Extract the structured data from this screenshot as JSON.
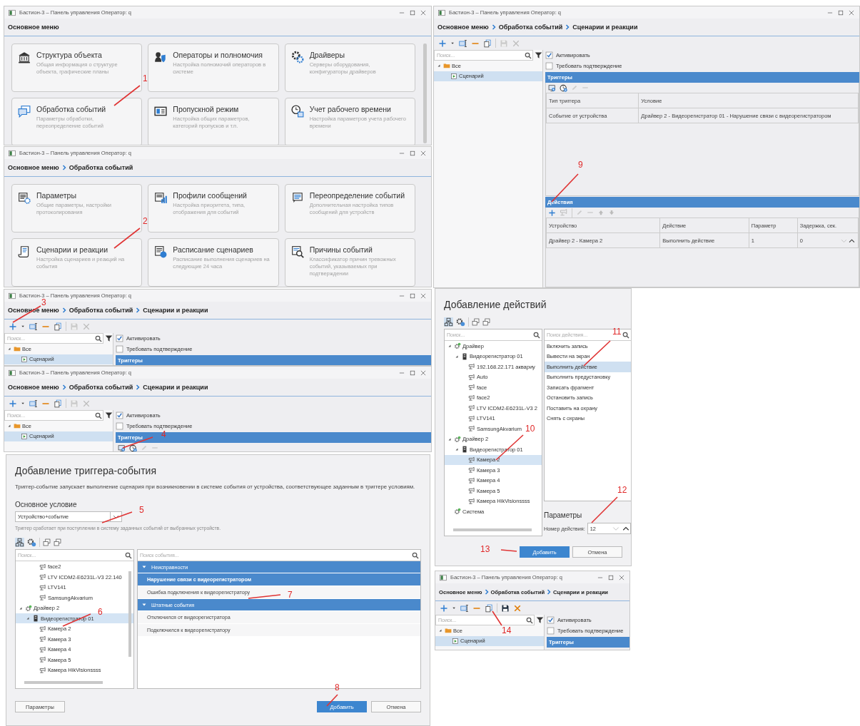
{
  "panels": [
    {
      "kind": "menu",
      "title": "Бастион-3 – Панель управления Оператор: q",
      "breadcrumb": [
        "Основное меню"
      ],
      "cards": [
        {
          "title": "Структура объекта",
          "description": "Общая информация о структуре объекта, графические планы"
        },
        {
          "title": "Операторы и полномочия",
          "description": "Настройка полномочий операторов в системе"
        },
        {
          "title": "Драйверы",
          "description": "Серверы оборудования, конфигураторы драйверов"
        },
        {
          "title": "Обработка событий",
          "description": "Параметры обработки, переопределение событий"
        },
        {
          "title": "Пропускной режим",
          "description": "Настройка общих параметров, категорий пропусков и т.п."
        },
        {
          "title": "Учет рабочего времени",
          "description": "Настройка параметров учета рабочего времени"
        }
      ]
    },
    {
      "kind": "menu",
      "title": "Бастион-3 – Панель управления Оператор: q",
      "breadcrumb": [
        "Основное меню",
        "Обработка событий"
      ],
      "cards": [
        {
          "title": "Параметры",
          "description": "Общие параметры, настройки протоколирования"
        },
        {
          "title": "Профили сообщений",
          "description": "Настройка приоритета, типа, отображения для событий"
        },
        {
          "title": "Переопределение событий",
          "description": "Дополнительная настройка типов сообщений для устройств"
        },
        {
          "title": "Сценарии и реакции",
          "description": "Настройка сценариев и реакций на события"
        },
        {
          "title": "Расписание сценариев",
          "description": "Расписание выполнения сценариев на следующие 24 часа"
        },
        {
          "title": "Причины событий",
          "description": "Классификатор причин тревожных событий, указываемых при подтверждении"
        }
      ]
    },
    {
      "kind": "scenario",
      "title": "Бастион-3 – Панель управления Оператор: q",
      "breadcrumb": [
        "Основное меню",
        "Обработка событий",
        "Сценарии и реакции"
      ],
      "save_enabled": false,
      "search_placeholder": "Поиск...",
      "tree": [
        {
          "label": "Все",
          "kind": "folder",
          "expanded": true,
          "selected": false,
          "children": [
            {
              "label": "Сценарий",
              "kind": "script",
              "selected": true
            }
          ]
        }
      ],
      "checkboxes": [
        {
          "label": "Активировать",
          "checked": true
        },
        {
          "label": "Требовать подтверждение",
          "checked": false
        }
      ],
      "triggers": {
        "title": "Триггеры"
      }
    },
    {
      "kind": "scenario",
      "title": "Бастион-3 – Панель управления Оператор: q",
      "breadcrumb": [
        "Основное меню",
        "Обработка событий",
        "Сценарии и реакции"
      ],
      "save_enabled": false,
      "search_placeholder": "Поиск...",
      "tree": [
        {
          "label": "Все",
          "kind": "folder",
          "expanded": true,
          "selected": false,
          "children": [
            {
              "label": "Сценарий",
              "kind": "script",
              "selected": true
            }
          ]
        }
      ],
      "checkboxes": [
        {
          "label": "Активировать",
          "checked": true
        },
        {
          "label": "Требовать подтверждение",
          "checked": false
        }
      ],
      "triggers": {
        "title": "Триггеры",
        "show_toolbar": true
      }
    },
    {
      "kind": "trigger_dialog",
      "title": "Добавление триггера-события",
      "description": "Триггер-событие запускает выполнение сценария при возникновении в системе события от устройства, соответствующее заданным в триггере условиям.",
      "condition_label": "Основное условие",
      "condition_value": "Устройство+событие",
      "hint": "Триггер сработает при поступлении в систему заданных событий от выбранных устройств.",
      "device_search_placeholder": "Поиск...",
      "devices": [
        {
          "children": [
            {
              "children": [
                {
                  "label": "face2",
                  "kind": "camera",
                  "selected": false
                },
                {
                  "label": "LTV ICDM2-E6231L-V3 22.140",
                  "kind": "camera",
                  "selected": false
                },
                {
                  "label": "LTV141",
                  "kind": "camera",
                  "selected": false
                },
                {
                  "label": "SamsungAkvarium",
                  "kind": "camera",
                  "selected": false
                }
              ]
            }
          ]
        },
        {
          "label": "Драйвер 2",
          "kind": "driver",
          "expanded": true,
          "selected": false,
          "children": [
            {
              "label": "Видеорегистратор 01",
              "kind": "recorder",
              "expanded": true,
              "selected": true,
              "children": [
                {
                  "label": "Камера 2",
                  "kind": "camera",
                  "selected": false
                },
                {
                  "label": "Камера 3",
                  "kind": "camera",
                  "selected": false
                },
                {
                  "label": "Камера 4",
                  "kind": "camera",
                  "selected": false
                },
                {
                  "label": "Камера 5",
                  "kind": "camera",
                  "selected": false
                },
                {
                  "label": "Камера HikVisionssss",
                  "kind": "camera",
                  "selected": false
                }
              ]
            }
          ]
        }
      ],
      "event_search_placeholder": "Поиск события...",
      "event_groups": [
        {
          "label": "Неисправности",
          "expanded": true,
          "items": [
            {
              "label": "Нарушение связи с видеорегистратором",
              "selected": true
            },
            {
              "label": "Ошибка подключения к видеорегистратору",
              "selected": false
            }
          ]
        },
        {
          "label": "Штатные события",
          "expanded": true,
          "items": [
            {
              "label": "Отключился от видеорегистратора",
              "selected": false
            },
            {
              "label": "Подключился к видеорегистратору",
              "selected": false
            }
          ]
        }
      ],
      "buttons": [
        {
          "label": "Параметры",
          "kind": "secondary"
        },
        {
          "label": "Добавить",
          "kind": "primary"
        },
        {
          "label": "Отмена",
          "kind": "secondary"
        }
      ]
    },
    {
      "kind": "scenario",
      "title": "Бастион-3 – Панель управления Оператор: q",
      "breadcrumb": [
        "Основное меню",
        "Обработка событий",
        "Сценарии и реакции"
      ],
      "save_enabled": false,
      "search_placeholder": "Поиск...",
      "tree": [
        {
          "label": "Все",
          "kind": "folder",
          "expanded": true,
          "selected": false,
          "children": [
            {
              "label": "Сценарий",
              "kind": "script",
              "selected": true
            }
          ]
        }
      ],
      "checkboxes": [
        {
          "label": "Активировать",
          "checked": true
        },
        {
          "label": "Требовать подтверждение",
          "checked": false
        }
      ],
      "triggers": {
        "title": "Триггеры",
        "show_toolbar": true,
        "columns": [
          "Тип триггера",
          "Условие"
        ],
        "rows": [
          [
            "Событие от устройства",
            "Драйвер 2 - Видеорегистратор 01 - Нарушение связи с видеорегистратором"
          ]
        ]
      },
      "actions": {
        "title": "Действия",
        "columns": [
          "Устройство",
          "Действие",
          "Параметр",
          "Задержка, сек."
        ],
        "rows": [
          [
            "Драйвер 2 - Камера 2",
            "Выполнить действие",
            "1",
            "0"
          ]
        ]
      }
    },
    {
      "kind": "action_dialog",
      "title": "Добавление действий",
      "device_search_placeholder": "Поиск...",
      "devices": [
        {
          "label": "Драйвер",
          "kind": "driver",
          "expanded": true,
          "selected": false,
          "children": [
            {
              "label": "Видеорегистратор 01",
              "kind": "recorder",
              "expanded": true,
              "selected": false,
              "children": [
                {
                  "label": "192.168.22.171 аквариу",
                  "kind": "camera",
                  "selected": false
                },
                {
                  "label": "Auto",
                  "kind": "camera",
                  "selected": false
                },
                {
                  "label": "face",
                  "kind": "camera",
                  "selected": false
                },
                {
                  "label": "face2",
                  "kind": "camera",
                  "selected": false
                },
                {
                  "label": "LTV ICDM2-E6231L-V3 2",
                  "kind": "camera",
                  "selected": false
                },
                {
                  "label": "LTV141",
                  "kind": "camera",
                  "selected": false
                },
                {
                  "label": "SamsungAkvarium",
                  "kind": "camera",
                  "selected": false
                }
              ]
            }
          ]
        },
        {
          "label": "Драйвер 2",
          "kind": "driver",
          "expanded": true,
          "selected": false,
          "children": [
            {
              "label": "Видеорегистратор 01",
              "kind": "recorder",
              "expanded": true,
              "selected": false,
              "children": [
                {
                  "label": "Камера 2",
                  "kind": "camera",
                  "selected": true
                },
                {
                  "label": "Камера 3",
                  "kind": "camera",
                  "selected": false
                },
                {
                  "label": "Камера 4",
                  "kind": "camera",
                  "selected": false
                },
                {
                  "label": "Камера 5",
                  "kind": "camera",
                  "selected": false
                },
                {
                  "label": "Камера HikVisionssss",
                  "kind": "camera",
                  "selected": false
                }
              ]
            }
          ]
        },
        {
          "label": "Система",
          "kind": "driver",
          "selected": false
        }
      ],
      "action_search_placeholder": "Поиск действия...",
      "actions": [
        {
          "label": "Включить запись",
          "selected": false
        },
        {
          "label": "Вывести на экран",
          "selected": false
        },
        {
          "label": "Выполнить действие",
          "selected": true
        },
        {
          "label": "Выполнить предустановку",
          "selected": false
        },
        {
          "label": "Записать фрагмент",
          "selected": false
        },
        {
          "label": "Остановить запись",
          "selected": false
        },
        {
          "label": "Поставить на охрану",
          "selected": false
        },
        {
          "label": "Снять с охраны",
          "selected": false
        }
      ],
      "params_title": "Параметры",
      "param_label": "Номер действия:",
      "param_value": "12",
      "buttons": [
        {
          "label": "Добавить",
          "kind": "primary"
        },
        {
          "label": "Отмена",
          "kind": "secondary"
        }
      ]
    },
    {
      "kind": "scenario",
      "title": "Бастион-3 – Панель управления Оператор: q",
      "breadcrumb": [
        "Основное меню",
        "Обработка событий",
        "Сценарии и реакции"
      ],
      "save_enabled": true,
      "search_placeholder": "Поиск...",
      "tree": [
        {
          "label": "Все",
          "kind": "folder",
          "expanded": true,
          "selected": false,
          "children": [
            {
              "label": "Сценарий",
              "kind": "script",
              "selected": true
            }
          ]
        }
      ],
      "checkboxes": [
        {
          "label": "Активировать",
          "checked": true
        },
        {
          "label": "Требовать подтверждение",
          "checked": false
        }
      ],
      "triggers": {
        "title": "Триггеры"
      }
    }
  ],
  "annotations": [
    {
      "label": "1"
    },
    {
      "label": "2"
    },
    {
      "label": "3"
    },
    {
      "label": "4"
    },
    {
      "label": "5"
    },
    {
      "label": "6"
    },
    {
      "label": "7"
    },
    {
      "label": "8"
    },
    {
      "label": "9"
    },
    {
      "label": "10"
    },
    {
      "label": "11"
    },
    {
      "label": "12"
    },
    {
      "label": "13"
    },
    {
      "label": "14"
    }
  ]
}
